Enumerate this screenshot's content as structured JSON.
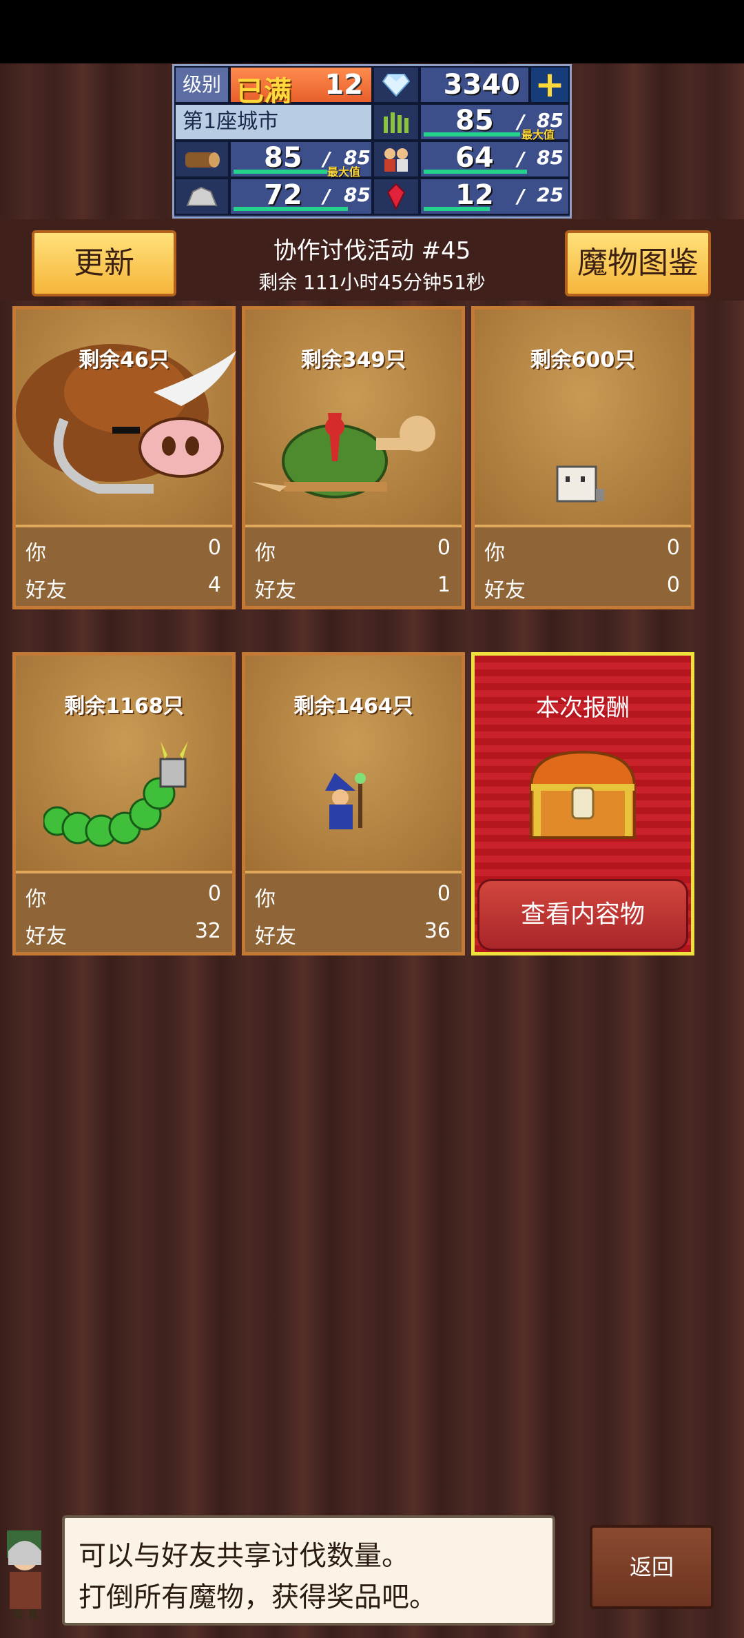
{
  "hud": {
    "level_label": "级别",
    "level_max_text": "已满",
    "level": "12",
    "gems": "3340",
    "city_name": "第1座城市",
    "crop": {
      "value": "85",
      "max": "85",
      "max_tag": "最大值"
    },
    "wood": {
      "value": "85",
      "max": "85",
      "max_tag": "最大值"
    },
    "farmers": {
      "value": "64",
      "max": "85"
    },
    "stone": {
      "value": "72",
      "max": "85"
    },
    "ruby": {
      "value": "12",
      "max": "25"
    },
    "icons": [
      "diamond-icon",
      "grass-icon",
      "wood-log-icon",
      "villager-icon",
      "stone-icon",
      "red-gem-icon",
      "plus-icon"
    ]
  },
  "header": {
    "refresh_label": "更新",
    "event_title": "协作讨伐活动 #45",
    "event_time": "剩余 111小时45分钟51秒",
    "bestiary_label": "魔物图鉴"
  },
  "labels": {
    "you": "你",
    "friend": "好友"
  },
  "cards": [
    {
      "remaining": "剩余46只",
      "you": "0",
      "friend": "4",
      "monster": "boar-monster"
    },
    {
      "remaining": "剩余349只",
      "you": "0",
      "friend": "1",
      "monster": "turtle-monster"
    },
    {
      "remaining": "剩余600只",
      "you": "0",
      "friend": "0",
      "monster": "small-ghost-monster"
    },
    {
      "remaining": "剩余1168只",
      "you": "0",
      "friend": "32",
      "monster": "caterpillar-monster"
    },
    {
      "remaining": "剩余1464只",
      "you": "0",
      "friend": "36",
      "monster": "wizard-monster"
    }
  ],
  "reward": {
    "title": "本次报酬",
    "view_label": "查看内容物"
  },
  "dialog": {
    "line1": "可以与好友共享讨伐数量。",
    "line2": "打倒所有魔物，获得奖品吧。"
  },
  "back_label": "返回"
}
